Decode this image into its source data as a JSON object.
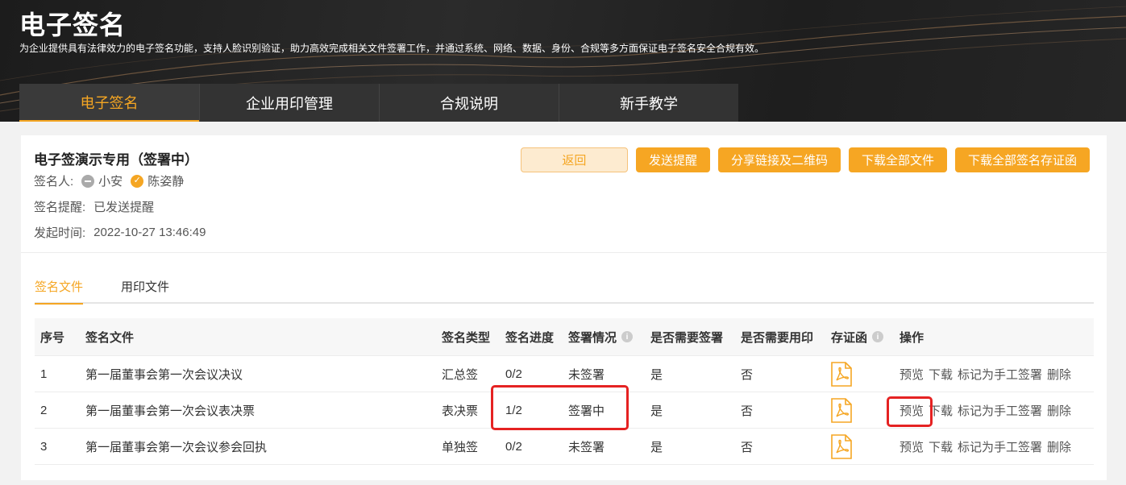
{
  "header": {
    "title": "电子签名",
    "description": "为企业提供具有法律效力的电子签名功能，支持人脸识别验证，助力高效完成相关文件签署工作，并通过系统、网络、数据、身份、合规等多方面保证电子签名安全合规有效。"
  },
  "main_tabs": [
    {
      "label": "电子签名",
      "active": true
    },
    {
      "label": "企业用印管理",
      "active": false
    },
    {
      "label": "合规说明",
      "active": false
    },
    {
      "label": "新手教学",
      "active": false
    }
  ],
  "doc": {
    "title": "电子签演示专用（签署中）",
    "signers_label": "签名人:",
    "signers": [
      {
        "name": "小安",
        "status": "pending"
      },
      {
        "name": "陈姿静",
        "status": "signed"
      }
    ],
    "reminder_label": "签名提醒:",
    "reminder_value": "已发送提醒",
    "start_label": "发起时间:",
    "start_value": "2022-10-27 13:46:49"
  },
  "buttons": {
    "back": "返回",
    "remind": "发送提醒",
    "share": "分享链接及二维码",
    "download_all": "下载全部文件",
    "download_certs": "下载全部签名存证函"
  },
  "sub_tabs": [
    {
      "label": "签名文件",
      "active": true
    },
    {
      "label": "用印文件",
      "active": false
    }
  ],
  "table": {
    "headers": {
      "index": "序号",
      "file": "签名文件",
      "type": "签名类型",
      "progress": "签名进度",
      "status": "签署情况",
      "need_sign": "是否需要签署",
      "need_seal": "是否需要用印",
      "cert": "存证函",
      "actions": "操作"
    },
    "rows": [
      {
        "index": "1",
        "file": "第一届董事会第一次会议决议",
        "type": "汇总签",
        "progress": "0/2",
        "status": "未签署",
        "need_sign": "是",
        "need_seal": "否"
      },
      {
        "index": "2",
        "file": "第一届董事会第一次会议表决票",
        "type": "表决票",
        "progress": "1/2",
        "status": "签署中",
        "need_sign": "是",
        "need_seal": "否"
      },
      {
        "index": "3",
        "file": "第一届董事会第一次会议参会回执",
        "type": "单独签",
        "progress": "0/2",
        "status": "未签署",
        "need_sign": "是",
        "need_seal": "否"
      }
    ],
    "actions": {
      "preview": "预览",
      "download": "下载",
      "mark_manual": "标记为手工签署",
      "delete": "删除"
    }
  },
  "colors": {
    "accent": "#f5a623",
    "highlight": "#e52222"
  }
}
